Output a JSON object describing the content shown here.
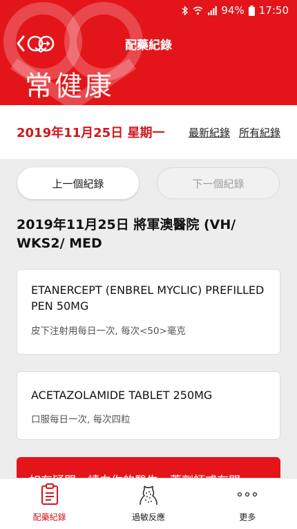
{
  "status_bar": {
    "battery": "94%",
    "time": "17:50"
  },
  "header": {
    "title": "配藥紀錄",
    "brand": "常健康"
  },
  "date_bar": {
    "date": "2019年11月25日 星期一",
    "latest_link": "最新紀錄",
    "all_link": "所有紀錄"
  },
  "pager": {
    "prev": "上一個紀錄",
    "next": "下一個紀錄"
  },
  "record": {
    "heading": "2019年11月25日 將軍澳醫院 (VH/ WKS2/ MED"
  },
  "medications": [
    {
      "name": "ETANERCEPT (ENBREL MYCLIC) PREFILLED PEN 50MG",
      "dosage": "皮下注射用每日一次, 每次<50>毫克"
    },
    {
      "name": "ACETAZOLAMIDE TABLET 250MG",
      "dosage": "口服每日一次, 每次四粒"
    }
  ],
  "notice": {
    "text": "如有疑問，請向你的醫生、藥劑師或有關"
  },
  "bottom_nav": [
    {
      "label": "配藥紀錄",
      "icon": "clipboard-icon",
      "active": true
    },
    {
      "label": "過敏反應",
      "icon": "allergy-body-icon",
      "active": false
    },
    {
      "label": "更多",
      "icon": "more-dots-icon",
      "active": false
    }
  ],
  "colors": {
    "brand_red": "#e3151b",
    "date_red": "#d3151b"
  }
}
